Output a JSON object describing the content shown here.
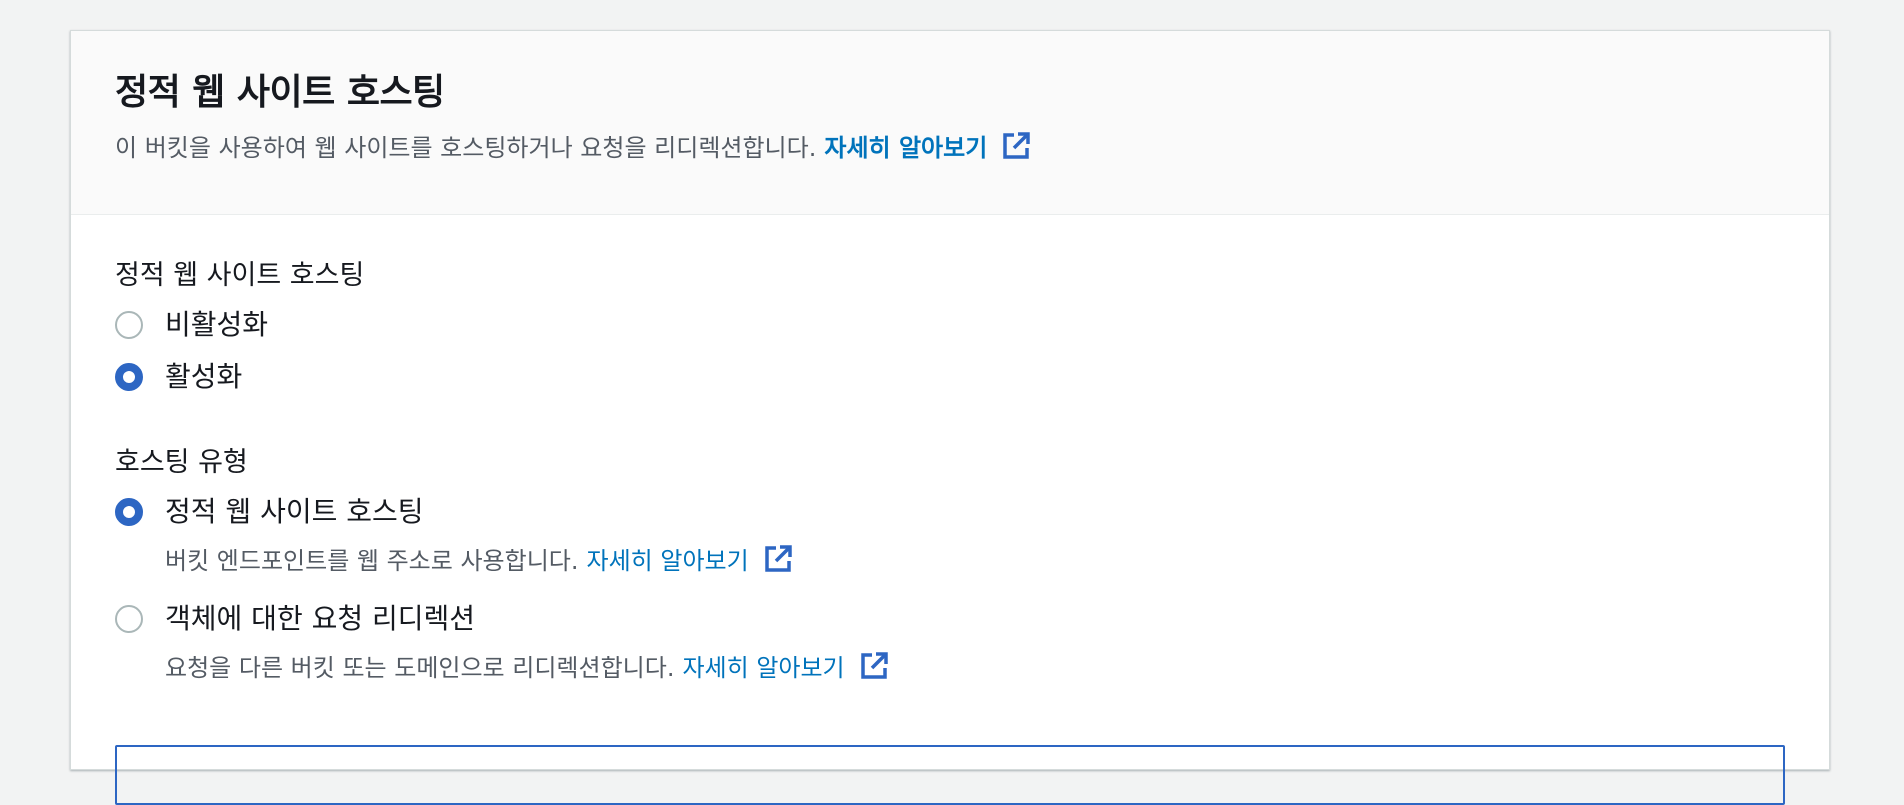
{
  "header": {
    "title": "정적 웹 사이트 호스팅",
    "description": "이 버킷을 사용하여 웹 사이트를 호스팅하거나 요청을 리디렉션합니다.",
    "learn_more": "자세히 알아보기"
  },
  "hosting_toggle": {
    "label": "정적 웹 사이트 호스팅",
    "options": [
      {
        "label": "비활성화",
        "checked": false
      },
      {
        "label": "활성화",
        "checked": true
      }
    ]
  },
  "hosting_type": {
    "label": "호스팅 유형",
    "options": [
      {
        "label": "정적 웹 사이트 호스팅",
        "description": "버킷 엔드포인트를 웹 주소로 사용합니다.",
        "learn_more": "자세히 알아보기",
        "checked": true
      },
      {
        "label": "객체에 대한 요청 리디렉션",
        "description": "요청을 다른 버킷 또는 도메인으로 리디렉션합니다.",
        "learn_more": "자세히 알아보기",
        "checked": false
      }
    ]
  },
  "icons": {
    "external": "external-link-icon"
  },
  "colors": {
    "accent": "#2d66c3",
    "link": "#0073bb",
    "text": "#16191f",
    "muted": "#545b64"
  }
}
